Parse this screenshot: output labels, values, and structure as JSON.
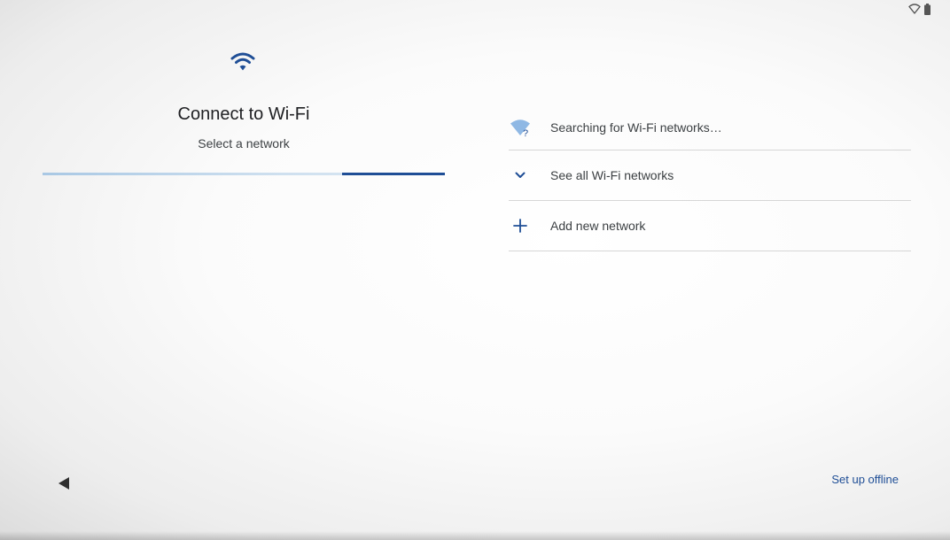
{
  "colors": {
    "accent": "#1f4e96",
    "text_primary": "#202124",
    "text_secondary": "#3c4043",
    "divider": "#d6d6d6"
  },
  "status_bar": {
    "icons": [
      "wifi-outline-icon",
      "battery-icon"
    ]
  },
  "setup": {
    "hero_icon": "wifi-icon",
    "title": "Connect to Wi-Fi",
    "subtitle": "Select a network",
    "progress_indeterminate": true
  },
  "networks": {
    "items": [
      {
        "icon": "wifi-unknown-icon",
        "label": "Searching for Wi-Fi networks…"
      },
      {
        "icon": "chevron-down-icon",
        "label": "See all Wi-Fi networks"
      },
      {
        "icon": "plus-icon",
        "label": "Add new network"
      }
    ]
  },
  "nav": {
    "back_icon": "back-triangle-icon",
    "offline_label": "Set up offline"
  }
}
